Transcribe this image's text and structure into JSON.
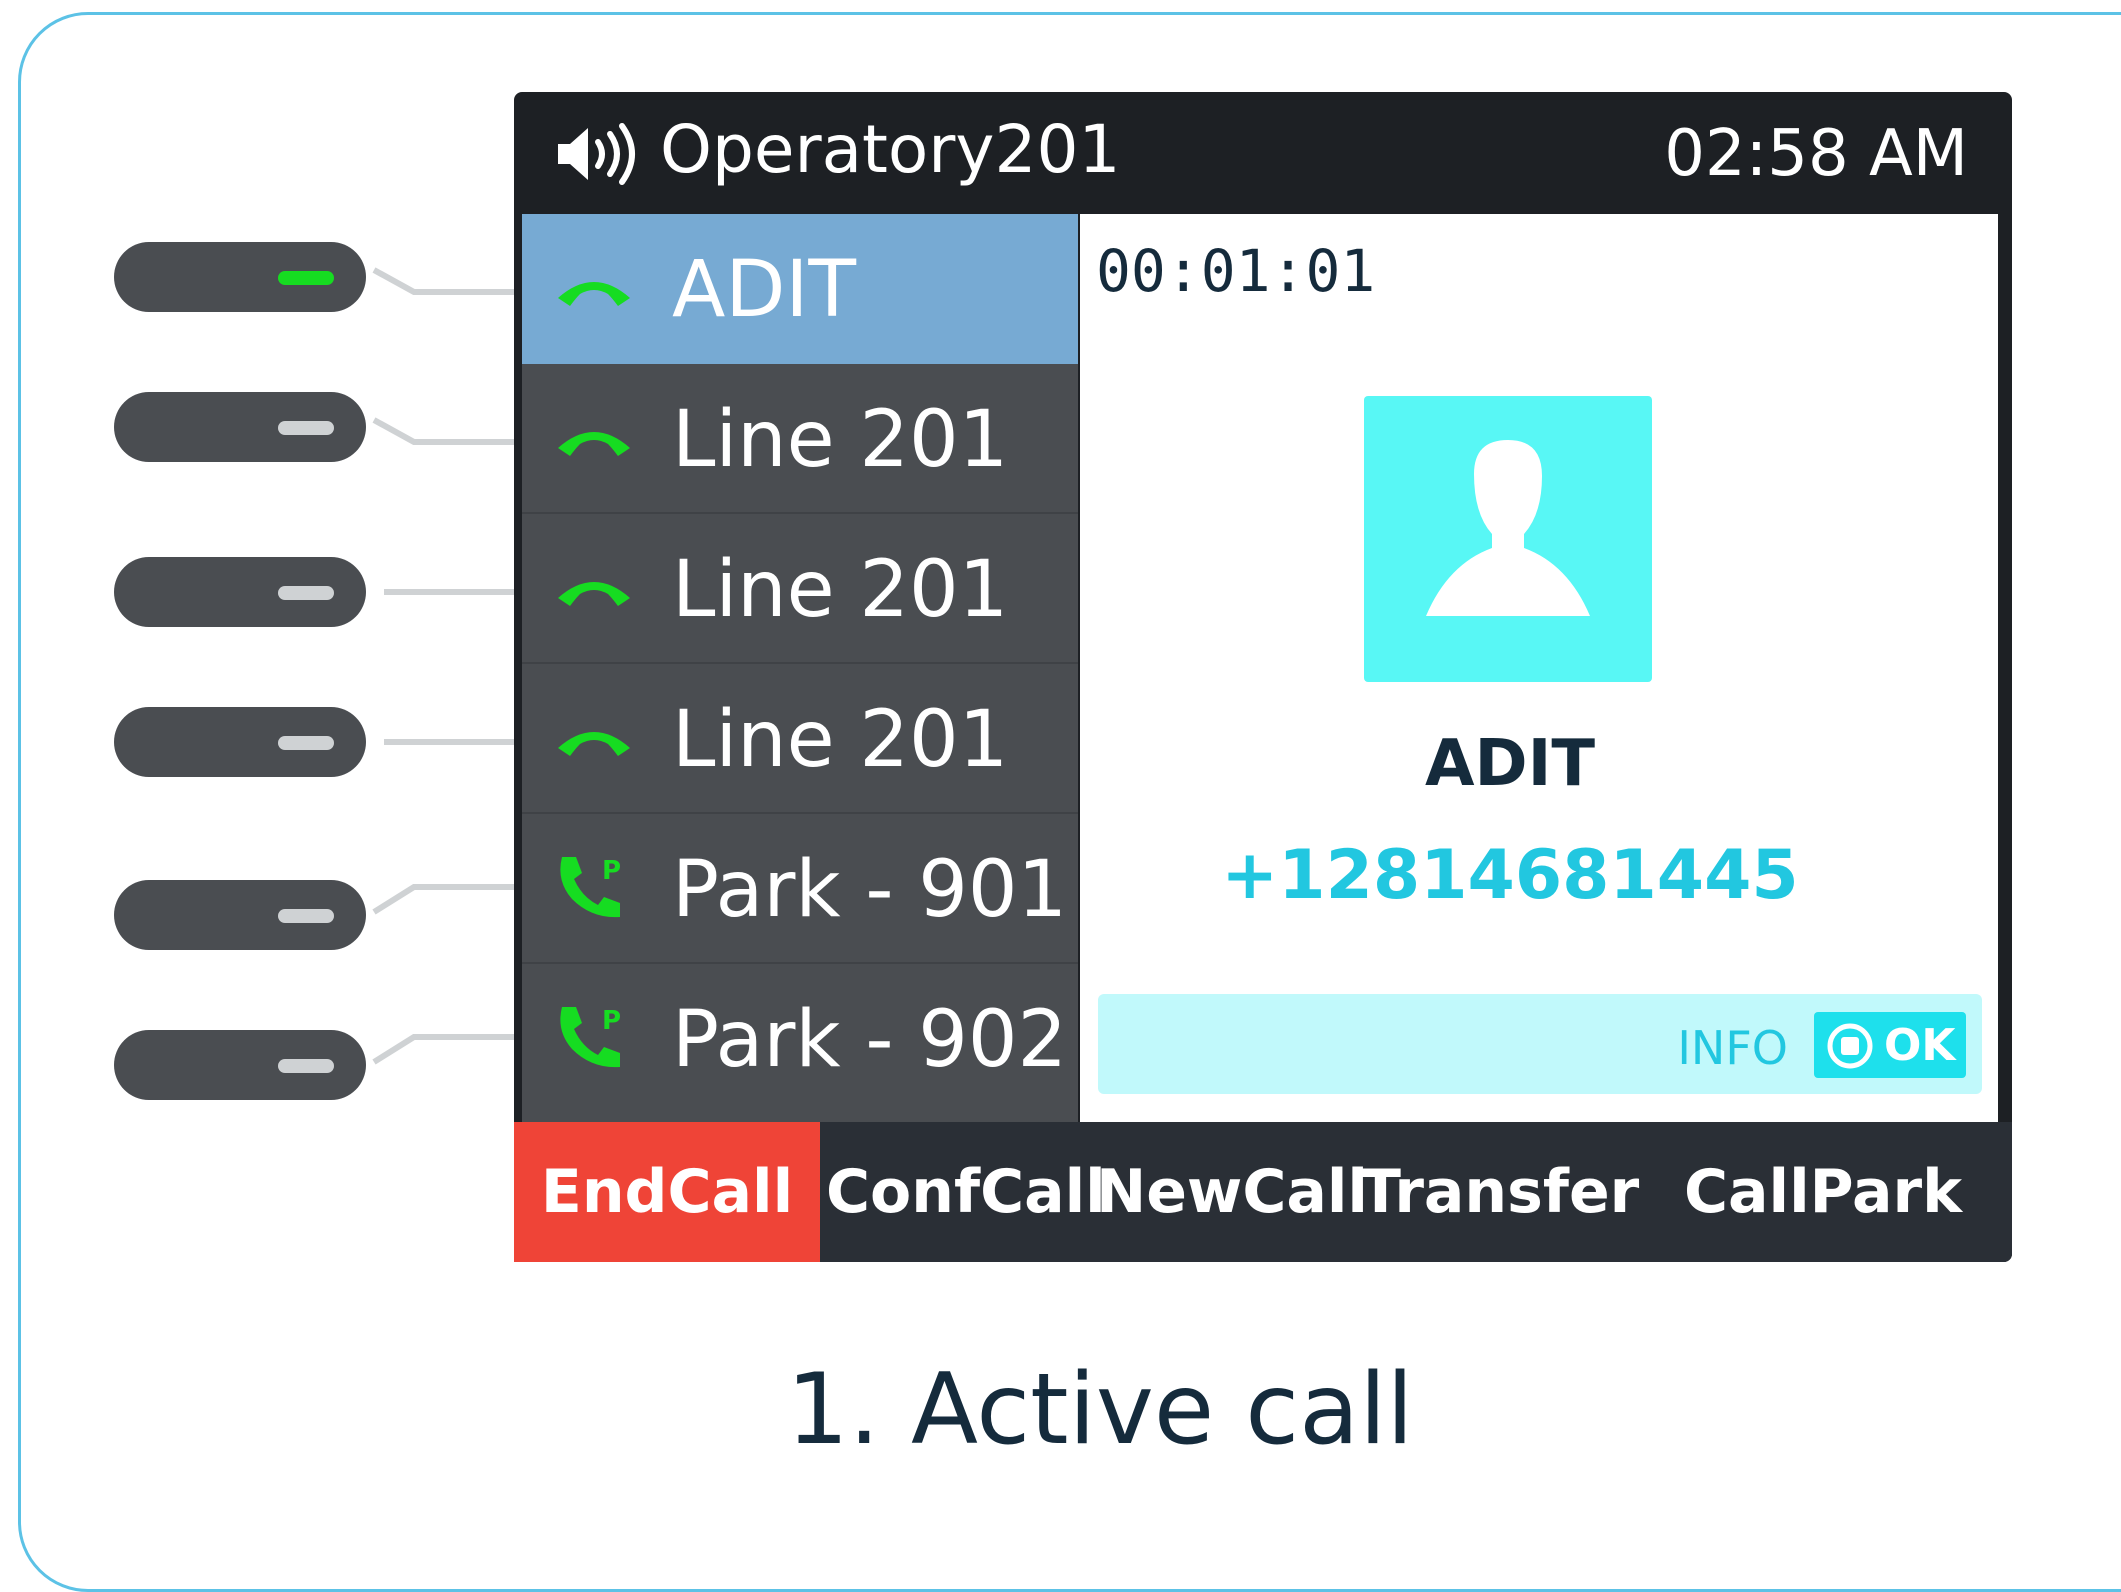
{
  "status_bar": {
    "account_name": "Operatory201",
    "clock": "02:58 AM",
    "speaker_icon": "speaker-volume-icon"
  },
  "line_keys": [
    {
      "label": "ADIT",
      "icon": "phone-handset-icon",
      "active": true,
      "led": "green"
    },
    {
      "label": "Line 201",
      "icon": "phone-handset-icon",
      "active": false,
      "led": "gray"
    },
    {
      "label": "Line 201",
      "icon": "phone-handset-icon",
      "active": false,
      "led": "gray"
    },
    {
      "label": "Line 201",
      "icon": "phone-handset-icon",
      "active": false,
      "led": "gray"
    },
    {
      "label": "Park - 901",
      "icon": "call-park-icon",
      "active": false,
      "led": "gray"
    },
    {
      "label": "Park - 902",
      "icon": "call-park-icon",
      "active": false,
      "led": "gray"
    }
  ],
  "call": {
    "duration": "00:01:01",
    "contact_name": "ADIT",
    "contact_number": "+12814681445",
    "avatar_icon": "person-avatar-icon",
    "info_label": "INFO",
    "ok_label": "OK"
  },
  "softkeys": [
    "EndCall",
    "ConfCall",
    "NewCall",
    "Transfer",
    "CallPark"
  ],
  "caption": "1. Active call",
  "colors": {
    "accent": "#22c7e0",
    "end_call": "#ef4437",
    "active_line": "#77aad3",
    "led_on": "#16dc21",
    "avatar_bg": "#58f7f5",
    "card_border": "#5cc2e6"
  }
}
